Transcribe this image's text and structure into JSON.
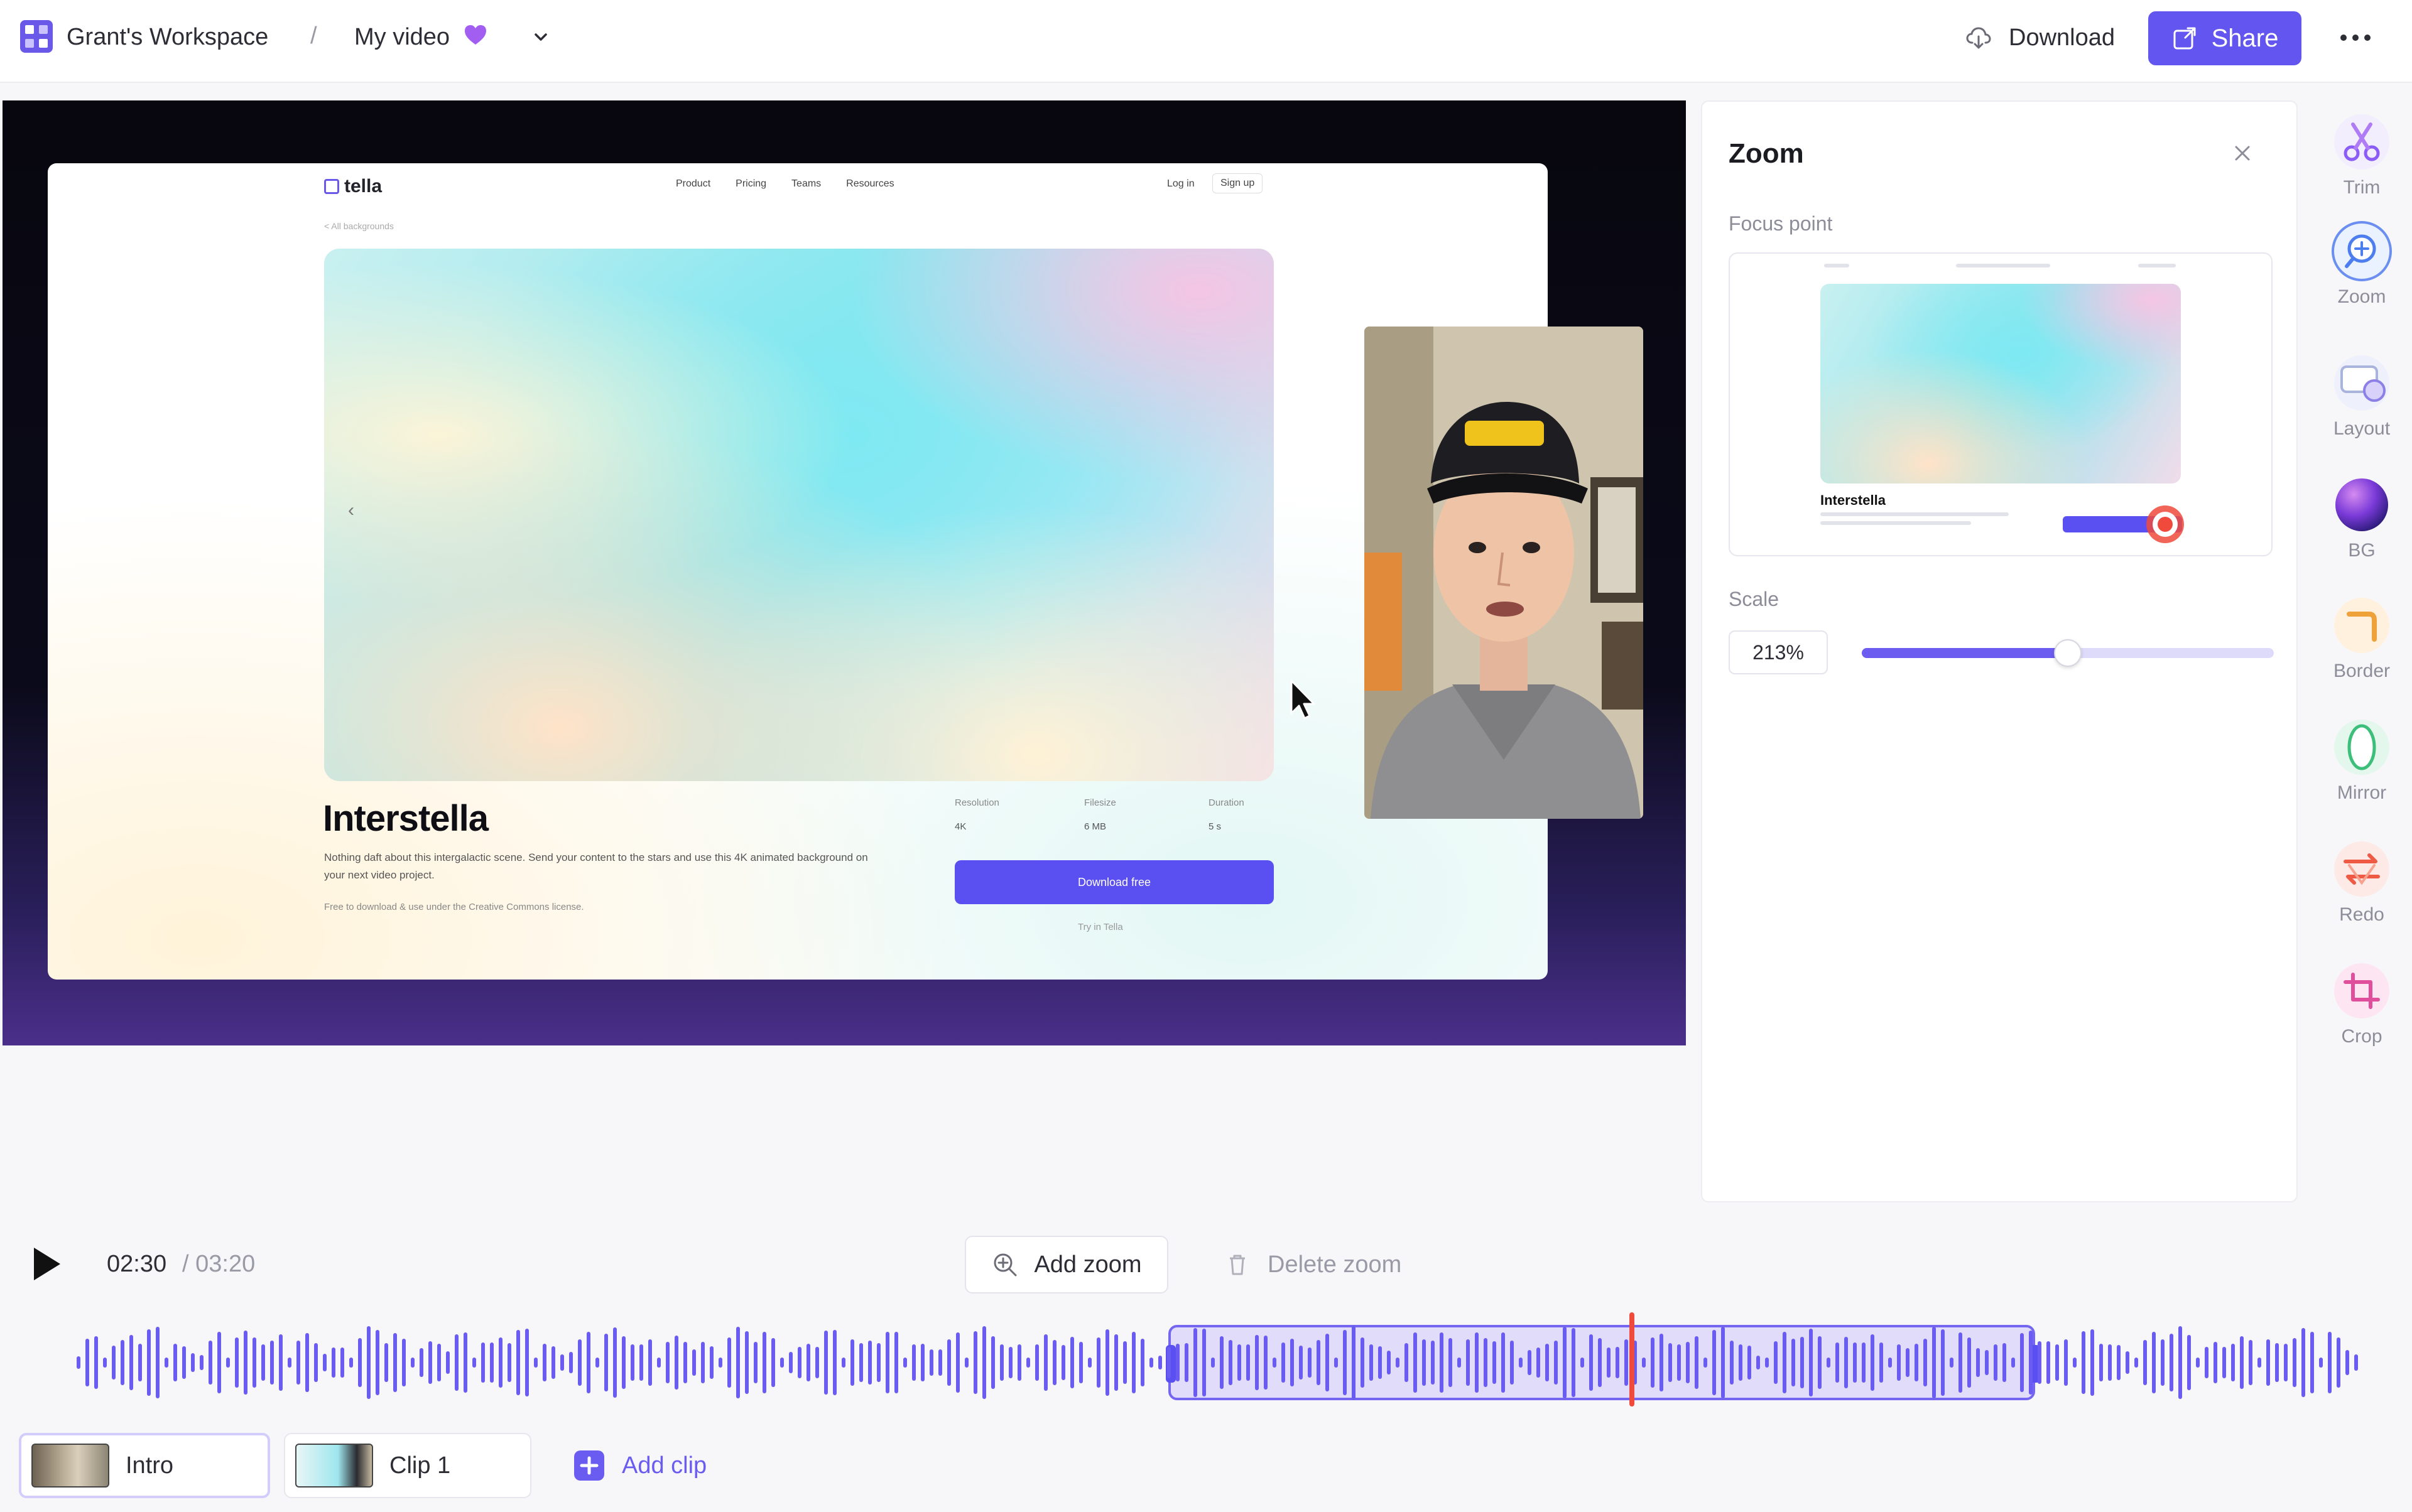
{
  "header": {
    "workspace_name": "Grant's Workspace",
    "separator": "/",
    "video_title": "My video",
    "download_label": "Download",
    "share_label": "Share"
  },
  "preview": {
    "site": {
      "logo_text": "tella",
      "nav": [
        "Product",
        "Pricing",
        "Teams",
        "Resources"
      ],
      "login": "Log in",
      "signup": "Sign up",
      "back_link": "< All backgrounds",
      "heading": "Interstella",
      "description": "Nothing daft about this intergalactic scene. Send your content to the stars and use this 4K animated background on your next video project.",
      "license_note": "Free to download & use under the Creative Commons license.",
      "meta": [
        {
          "label": "Resolution",
          "value": "4K"
        },
        {
          "label": "Filesize",
          "value": "6 MB"
        },
        {
          "label": "Duration",
          "value": "5 s"
        }
      ],
      "cta": "Download free",
      "try_link": "Try in Tella"
    }
  },
  "zoom_panel": {
    "title": "Zoom",
    "focus_label": "Focus point",
    "thumb_heading": "Interstella",
    "scale_label": "Scale",
    "scale_value": "213%",
    "scale_fraction": 0.5
  },
  "tools": [
    {
      "label": "Trim",
      "icon": "scissors-icon"
    },
    {
      "label": "Zoom",
      "icon": "zoom-icon"
    },
    {
      "label": "Layout",
      "icon": "layout-icon"
    },
    {
      "label": "BG",
      "icon": "background-icon"
    },
    {
      "label": "Border",
      "icon": "border-icon"
    },
    {
      "label": "Mirror",
      "icon": "mirror-icon"
    },
    {
      "label": "Redo",
      "icon": "redo-icon"
    },
    {
      "label": "Crop",
      "icon": "crop-icon"
    }
  ],
  "player": {
    "current_time": "02:30",
    "total_time": "/ 03:20",
    "add_zoom_label": "Add zoom",
    "delete_zoom_label": "Delete zoom"
  },
  "clips": [
    {
      "label": "Intro",
      "selected": true
    },
    {
      "label": "Clip 1",
      "selected": false
    }
  ],
  "add_clip_label": "Add clip",
  "colors": {
    "accent": "#6355ef",
    "playhead": "#ef4a3c",
    "waveform": "#6a5cf0"
  }
}
